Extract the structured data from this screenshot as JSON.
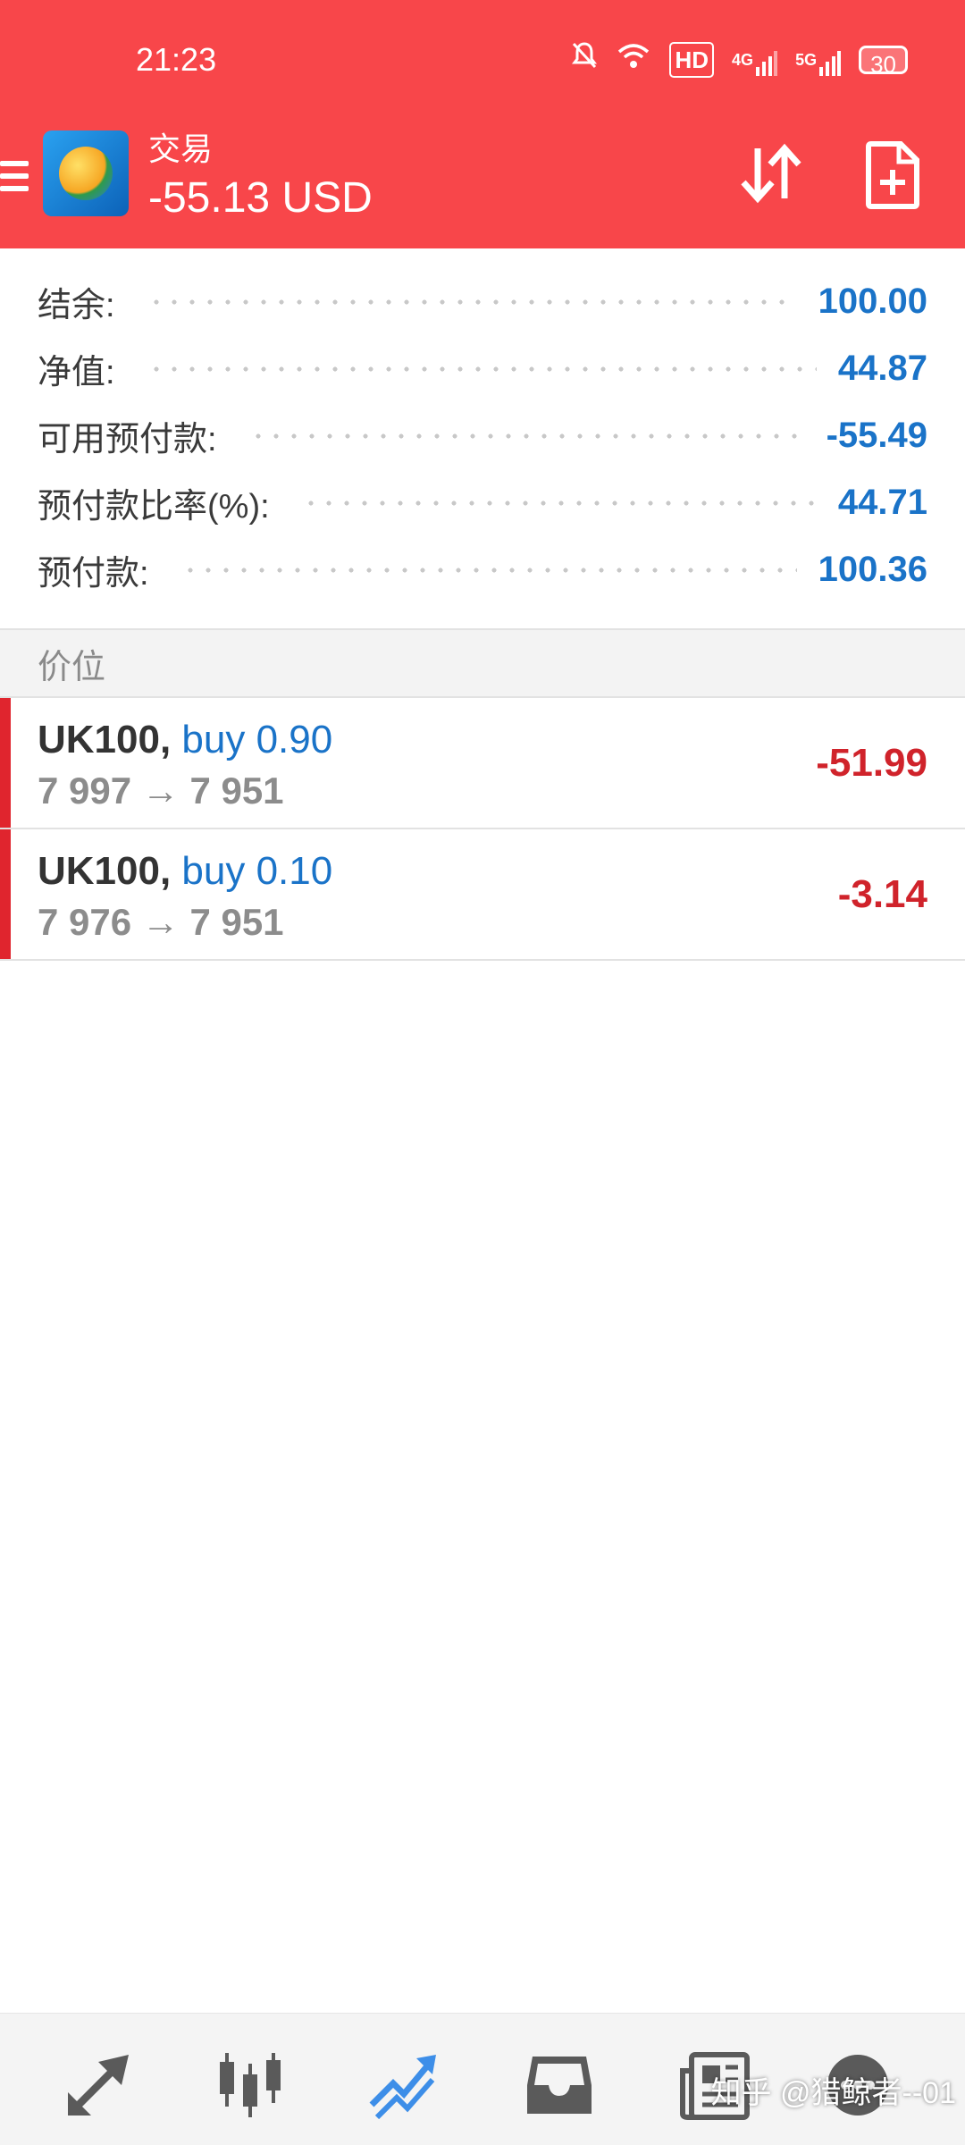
{
  "status_bar": {
    "time": "21:23",
    "network_hd": "HD",
    "network_4g": "4G",
    "network_5g": "5G",
    "battery": "30"
  },
  "header": {
    "title": "交易",
    "balance": "-55.13 USD"
  },
  "account": [
    {
      "label": "结余:",
      "value": "100.00"
    },
    {
      "label": "净值:",
      "value": "44.87"
    },
    {
      "label": "可用预付款:",
      "value": "-55.49"
    },
    {
      "label": "预付款比率(%):",
      "value": "44.71"
    },
    {
      "label": "预付款:",
      "value": "100.36"
    }
  ],
  "section_title": "价位",
  "positions": [
    {
      "symbol": "UK100,",
      "direction": "buy 0.90",
      "prices": "7 997 → 7 951",
      "profit": "-51.99"
    },
    {
      "symbol": "UK100,",
      "direction": "buy 0.10",
      "prices": "7 976 → 7 951",
      "profit": "-3.14"
    }
  ],
  "colors": {
    "header_bg": "#f8464a",
    "value_blue": "#1a73c8",
    "loss_red": "#d0232b",
    "active_nav": "#3d8ee8"
  },
  "bottom_nav": [
    "quotes-icon",
    "chart-icon",
    "trade-icon",
    "history-icon",
    "news-icon",
    "chat-icon"
  ],
  "watermark": "知乎 @猎鲸者--01"
}
